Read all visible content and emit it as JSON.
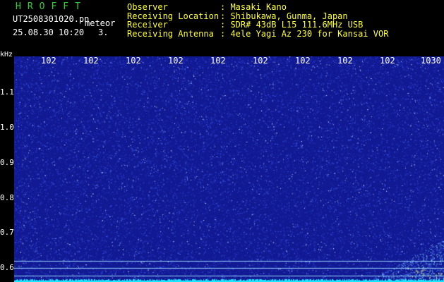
{
  "header": {
    "brand": "HROFFT",
    "file_name": "UT2508301020.pn",
    "kind": "meteor",
    "timestamp": "25.08.30 10:20",
    "count": "3.",
    "info": [
      {
        "label": "Observer",
        "value": ": Masaki Kano"
      },
      {
        "label": "Receiving Location",
        "value": ": Shibukawa, Gunma, Japan"
      },
      {
        "label": "Receiver",
        "value": ": SDR# 43dB L15 111.6MHz USB"
      },
      {
        "label": "Receiving Antenna",
        "value": ": 4ele Yagi Az 230 for Kansai VOR"
      }
    ]
  },
  "spectrogram": {
    "unit": "kHz",
    "y_ticks": [
      "1.1",
      "1.0",
      "0.9",
      "0.8",
      "0.7",
      "0.6"
    ],
    "x_ticks": [
      "102",
      "102",
      "102",
      "102",
      "102",
      "102",
      "102",
      "102",
      "102",
      "1030"
    ],
    "colors": {
      "background": "#121a93",
      "dots": "#3f6bff",
      "band": "#19e6ff",
      "reference_lines": "#9ad8ff"
    }
  }
}
